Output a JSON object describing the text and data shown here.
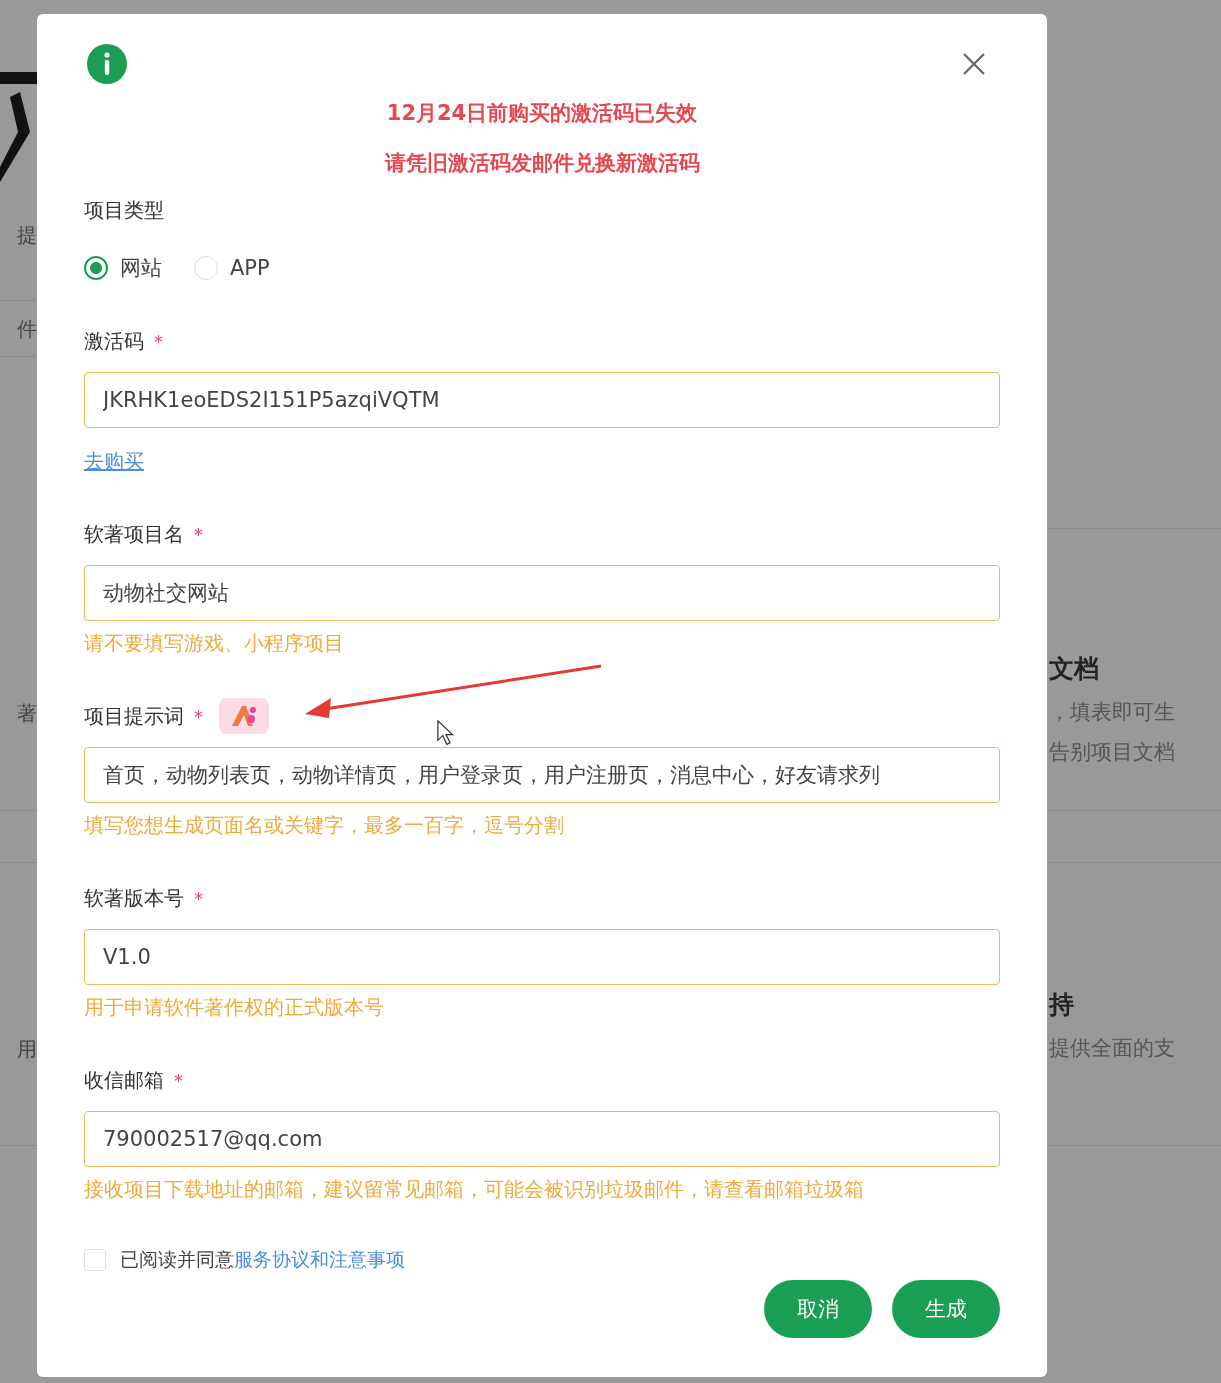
{
  "background": {
    "left_texts": [
      "提",
      "件",
      "著",
      "用"
    ],
    "right_texts": [
      {
        "kind": "heading",
        "text": "文档"
      },
      {
        "kind": "body",
        "text": "，填表即可生"
      },
      {
        "kind": "body",
        "text": "告别项目文档"
      },
      {
        "kind": "heading",
        "text": "持"
      },
      {
        "kind": "body",
        "text": "提供全面的支"
      }
    ]
  },
  "dialog": {
    "notice": [
      "12月24日前购买的激活码已失效",
      "请凭旧激活码发邮件兑换新激活码"
    ],
    "project_type": {
      "label": "项目类型",
      "options": [
        {
          "label": "网站",
          "selected": true
        },
        {
          "label": "APP",
          "selected": false
        }
      ]
    },
    "fields": [
      {
        "kind": "text",
        "label": "激活码",
        "required_mark": "*",
        "value": "JKRHK1eoEDS2I151P5azqiVQTM",
        "link": "去购买"
      },
      {
        "kind": "text",
        "label": "软著项目名",
        "required_mark": "*",
        "value": "动物社交网站",
        "hint": "请不要填写游戏、小程序项目"
      },
      {
        "kind": "prompt",
        "label": "项目提示词",
        "required_mark": "*",
        "value": "首页，动物列表页，动物详情页，用户登录页，用户注册页，消息中心，好友请求列",
        "hint": "填写您想生成页面名或关键字，最多一百字，逗号分割"
      },
      {
        "kind": "text",
        "label": "软著版本号",
        "required_mark": "*",
        "value": "V1.0",
        "hint": "用于申请软件著作权的正式版本号"
      },
      {
        "kind": "text",
        "label": "收信邮箱",
        "required_mark": "*",
        "value": "790002517@qq.com",
        "hint": "接收项目下载地址的邮箱，建议留常见邮箱，可能会被识别垃圾邮件，请查看邮箱垃圾箱"
      }
    ],
    "agreement": {
      "checked": false,
      "text": "已阅读并同意",
      "link": "服务协议和注意事项"
    },
    "buttons": [
      "取消",
      "生成"
    ]
  }
}
